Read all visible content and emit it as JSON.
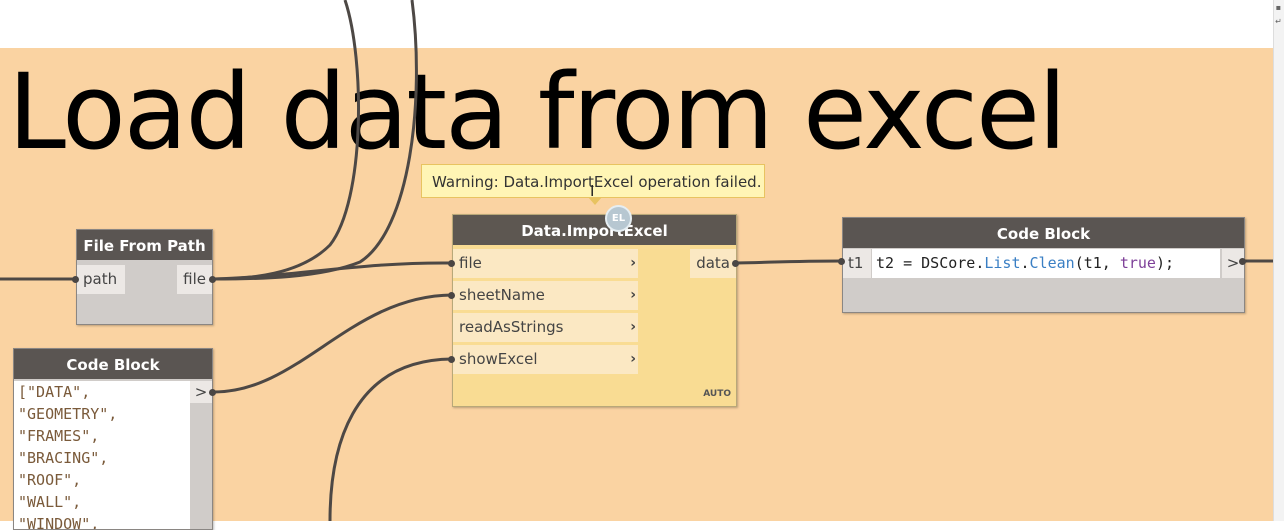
{
  "group": {
    "title": "Load data from excel",
    "color": "#fad3a2"
  },
  "tooltip": {
    "text": "Warning: Data.ImportExcel operation failed."
  },
  "avatar": {
    "initials": "EL"
  },
  "nodes": {
    "file_from_path": {
      "title": "File From Path",
      "input": "path",
      "output": "file"
    },
    "import_excel": {
      "title": "Data.ImportExcel",
      "inputs": [
        "file",
        "sheetName",
        "readAsStrings",
        "showExcel"
      ],
      "output": "data",
      "lacing": "AUTO",
      "state": "warning",
      "color": "#f9dc93"
    },
    "code_block_right": {
      "title": "Code Block",
      "port": "t1",
      "code_prefix": "t2 = DSCore.",
      "code_list": "List",
      "code_dot": ".",
      "code_clean": "Clean",
      "code_args": "(t1, ",
      "code_true": "true",
      "code_end": ");",
      "output_chevron": ">"
    },
    "code_block_left": {
      "title": "Code Block",
      "lines": [
        "[\"DATA\",",
        "\"GEOMETRY\",",
        "\"FRAMES\",",
        "\"BRACING\",",
        "\"ROOF\",",
        "\"WALL\",",
        "\"WINDOW\","
      ],
      "output_chevron": ">"
    }
  },
  "chevron": "›",
  "icons": [
    "chevron-right-icon",
    "cursor-icon"
  ]
}
